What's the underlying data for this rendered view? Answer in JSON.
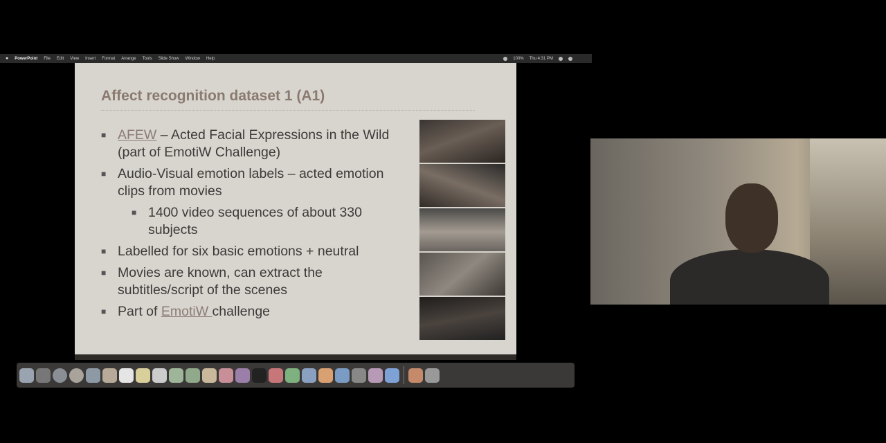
{
  "menubar": {
    "app": "PowerPoint",
    "items": [
      "File",
      "Edit",
      "View",
      "Insert",
      "Format",
      "Arrange",
      "Tools",
      "Slide Show",
      "Window",
      "Help"
    ],
    "battery": "100%",
    "clock": "Thu 4:31 PM"
  },
  "slide": {
    "title": "Affect recognition dataset 1 (A1)",
    "b1_link": "AFEW",
    "b1_rest": " – Acted Facial Expressions in the Wild (part of EmotiW Challenge)",
    "b2": "Audio-Visual emotion labels – acted emotion clips from movies",
    "b2_sub": "1400 video sequences of about 330 subjects",
    "b3": "Labelled for six basic emotions + neutral",
    "b4": "Movies are known, can extract the subtitles/script of the scenes",
    "b5_pre": "Part of ",
    "b5_link": "EmotiW ",
    "b5_post": "challenge"
  },
  "dock": {
    "icon_names": [
      "finder-icon",
      "launchpad-icon",
      "safari-icon",
      "chrome-icon",
      "mail-icon",
      "contacts-icon",
      "calendar-icon",
      "notes-icon",
      "reminders-icon",
      "messages-icon",
      "facetime-icon",
      "photos-icon",
      "music-icon",
      "podcasts-icon",
      "tv-icon",
      "news-icon",
      "numbers-icon",
      "keynote-icon",
      "pages-icon",
      "app-store-icon",
      "system-preferences-icon",
      "slack-icon",
      "zoom-icon",
      "powerpoint-icon",
      "trash-icon"
    ]
  },
  "colors": {
    "slide_bg": "#d8d5cf",
    "title": "#8a7a70",
    "body_text": "#3c3a38",
    "link": "#8b7b74"
  }
}
